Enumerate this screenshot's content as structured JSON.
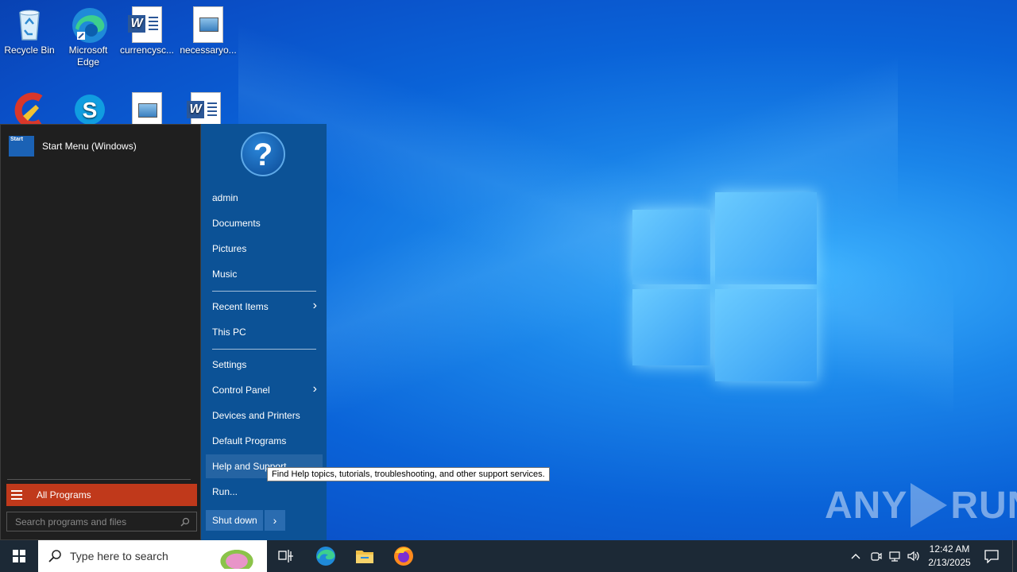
{
  "desktop": {
    "icons": [
      {
        "label": "Recycle Bin"
      },
      {
        "label": "Microsoft Edge"
      },
      {
        "label": "currencysc..."
      },
      {
        "label": "necessaryo..."
      }
    ]
  },
  "start_menu": {
    "pinned_item": {
      "label": "Start Menu (Windows)",
      "icon_text": "Start"
    },
    "all_programs_label": "All Programs",
    "search_placeholder": "Search programs and files",
    "right_items": {
      "user": "admin",
      "documents": "Documents",
      "pictures": "Pictures",
      "music": "Music",
      "recent_items": "Recent Items",
      "this_pc": "This PC",
      "settings": "Settings",
      "control_panel": "Control Panel",
      "devices_printers": "Devices and Printers",
      "default_programs": "Default Programs",
      "help_support": "Help and Support",
      "run": "Run..."
    },
    "help_icon_glyph": "?",
    "shutdown_label": "Shut down",
    "tooltip": "Find Help topics, tutorials, troubleshooting, and other support services."
  },
  "watermark": {
    "left": "ANY",
    "right": "RUN"
  },
  "taskbar": {
    "search_placeholder": "Type here to search",
    "clock_time": "12:42 AM",
    "clock_date": "2/13/2025"
  },
  "colors": {
    "start_left_bg": "#1f1f1f",
    "start_right_bg": "#0c5296",
    "all_programs_bg": "#c0391b",
    "taskbar_bg": "#1c2936"
  }
}
